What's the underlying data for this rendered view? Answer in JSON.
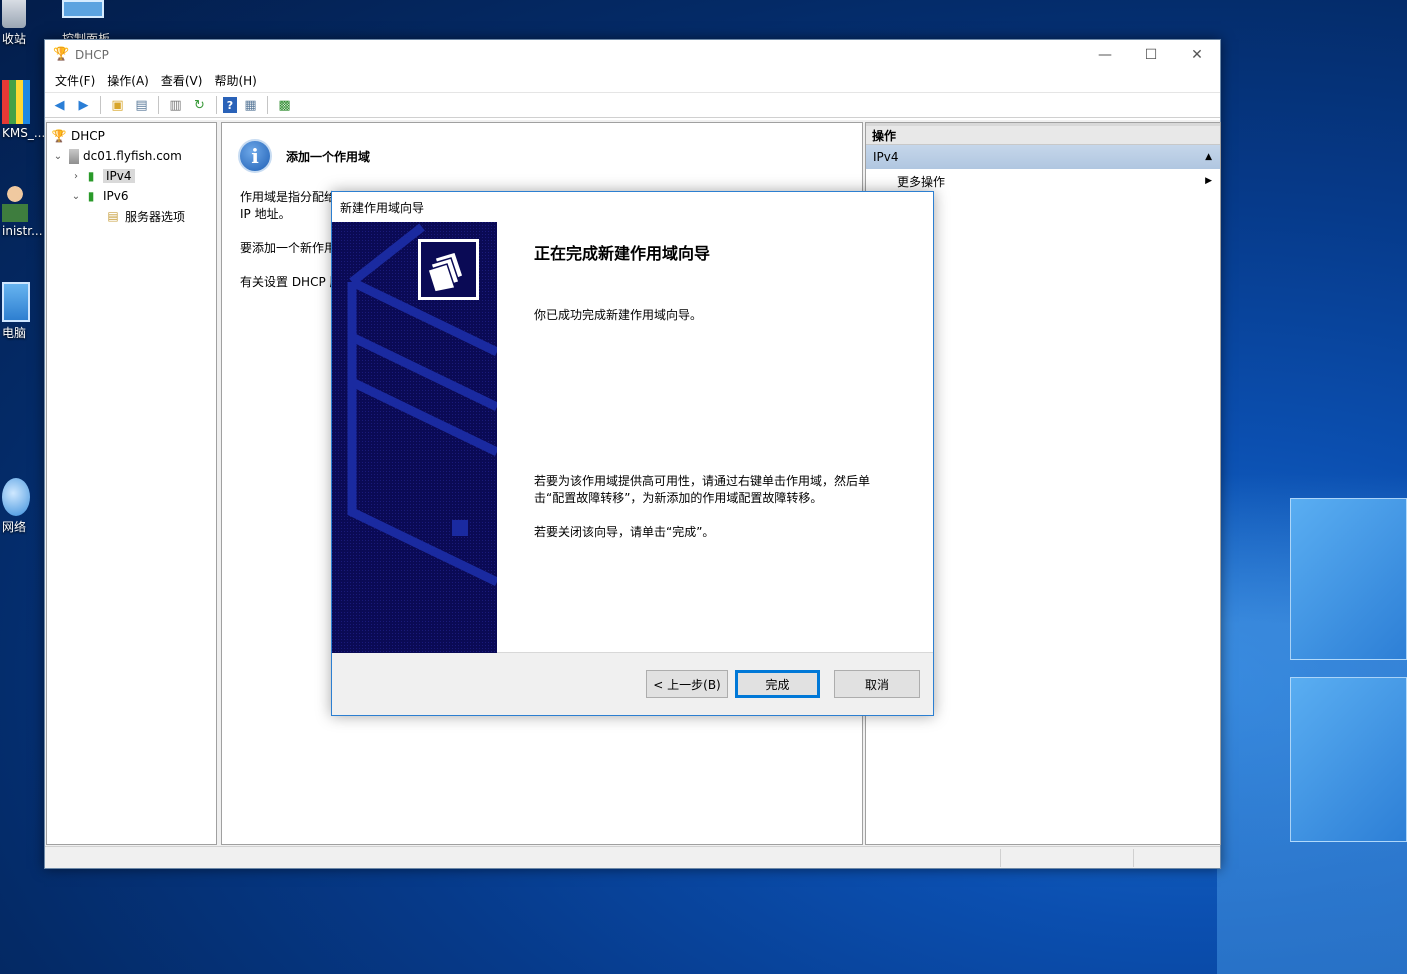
{
  "desktop": {
    "icons": [
      {
        "name": "recycle-bin",
        "label": "收站"
      },
      {
        "name": "control-panel",
        "label": "控制面板"
      },
      {
        "name": "kms",
        "label": "KMS_..."
      },
      {
        "name": "administrator",
        "label": "inistr..."
      },
      {
        "name": "this-pc",
        "label": "电脑"
      },
      {
        "name": "network",
        "label": "网络"
      }
    ]
  },
  "window": {
    "title": "DHCP",
    "controls": {
      "minimize": "—",
      "maximize": "☐",
      "close": "✕"
    }
  },
  "menubar": {
    "items": [
      "文件(F)",
      "操作(A)",
      "查看(V)",
      "帮助(H)"
    ]
  },
  "tree": {
    "root": "DHCP",
    "server": "dc01.flyfish.com",
    "ipv4": "IPv4",
    "ipv6": "IPv6",
    "server_options": "服务器选项"
  },
  "content": {
    "title": "添加一个作用域",
    "para1_line1": "作用域是指分配给",
    "para1_line2": "IP 地址。",
    "para2": "要添加一个新作用",
    "para3": "有关设置 DHCP 服"
  },
  "actions": {
    "header": "操作",
    "group": "IPv4",
    "more": "更多操作"
  },
  "wizard": {
    "title": "新建作用域向导",
    "heading": "正在完成新建作用域向导",
    "success_text": "你已成功完成新建作用域向导。",
    "ha_line1": "若要为该作用域提供高可用性，请通过右键单击作用域，然后单",
    "ha_line2": "击“配置故障转移”，为新添加的作用域配置故障转移。",
    "close_text": "若要关闭该向导，请单击“完成”。",
    "buttons": {
      "back": "< 上一步(B)",
      "finish": "完成",
      "cancel": "取消"
    }
  },
  "colors": {
    "banner": "#0a0a55",
    "accent": "#0078d7",
    "selected_group": "#b0c6e0"
  }
}
